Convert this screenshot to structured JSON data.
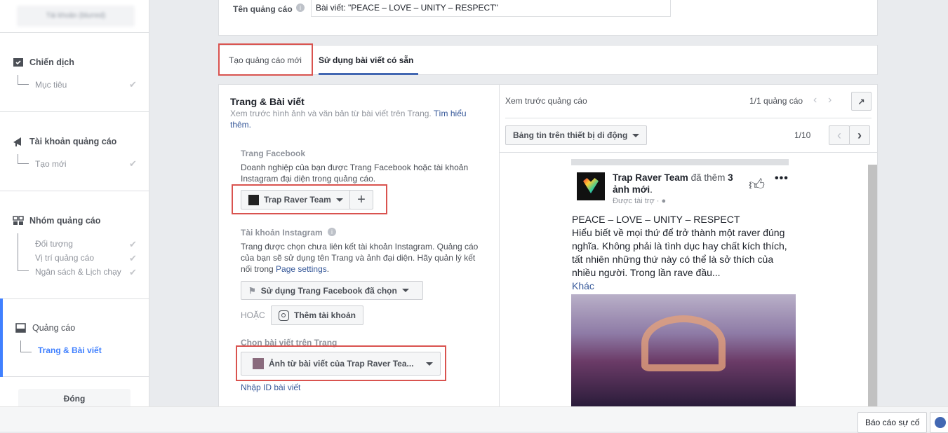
{
  "sidebar": {
    "account_label": "Tài khoản (blurred)",
    "sections": [
      {
        "title": "Chiến dịch",
        "icon": "campaign-check-icon",
        "items": [
          {
            "label": "Mục tiêu",
            "done": true
          }
        ]
      },
      {
        "title": "Tài khoản quảng cáo",
        "icon": "megaphone-icon",
        "items": [
          {
            "label": "Tạo mới",
            "done": true
          }
        ]
      },
      {
        "title": "Nhóm quảng cáo",
        "icon": "grid-icon",
        "items": [
          {
            "label": "Đối tượng",
            "done": true
          },
          {
            "label": "Vị trí quảng cáo",
            "done": true
          },
          {
            "label": "Ngân sách & Lịch chạy",
            "done": true
          }
        ]
      },
      {
        "title": "Quảng cáo",
        "icon": "ad-icon",
        "items": [
          {
            "label": "Trang & Bài viết",
            "active": true
          }
        ]
      }
    ],
    "close_label": "Đóng"
  },
  "ad_name": {
    "label": "Tên quảng cáo",
    "value": "Bài viết: \"PEACE – LOVE – UNITY – RESPECT\""
  },
  "tabs": [
    {
      "label": "Tạo quảng cáo mới"
    },
    {
      "label": "Sử dụng bài viết có sẵn",
      "active": true
    }
  ],
  "left": {
    "title": "Trang & Bài viết",
    "desc": "Xem trước hình ảnh và văn bản từ bài viết trên Trang.",
    "learn_more": "Tìm hiểu thêm.",
    "fb_page": {
      "title": "Trang Facebook",
      "desc": "Doanh nghiệp của bạn được Trang Facebook hoặc tài khoản Instagram đại diện trong quảng cáo.",
      "selected": "Trap Raver Team",
      "add": "+"
    },
    "instagram": {
      "title": "Tài khoản Instagram",
      "desc": "Trang được chọn chưa liên kết tài khoản Instagram. Quảng cáo của bạn sẽ sử dụng tên Trang và ảnh đại diện. Hãy quản lý kết nối trong",
      "link": "Page settings",
      "dot": ".",
      "selected": "Sử dụng Trang Facebook đã chọn",
      "or": "HOẶC",
      "add_account": "Thêm tài khoản"
    },
    "post": {
      "title": "Chọn bài viết trên Trang",
      "selected": "Ảnh từ bài viết của Trap Raver Tea...",
      "enter_id": "Nhập ID bài viết"
    }
  },
  "preview": {
    "title": "Xem trước quảng cáo",
    "count": "1/1 quảng cáo",
    "placement": "Bảng tin trên thiết bị di động",
    "page_count": "1/10",
    "post": {
      "page": "Trap Raver Team",
      "action": " đã thêm ",
      "num": "3",
      "photos": "ảnh mới",
      "dot": ".",
      "sponsored": "Được tài trợ · ",
      "text1": "PEACE – LOVE – UNITY – RESPECT",
      "text2": "Hiểu biết về mọi thứ để trở thành một raver đúng nghĩa. Không phải là tình dục hay chất kích thích, tất nhiên những thứ này có thể là sở thích của nhiều người. Trong lần rave đầu...",
      "more": "Khác"
    }
  },
  "footer": {
    "report": "Báo cáo sự cố"
  },
  "colors": {
    "accent": "#4267b2",
    "highlight": "#d9534f",
    "active": "#4080ff"
  }
}
